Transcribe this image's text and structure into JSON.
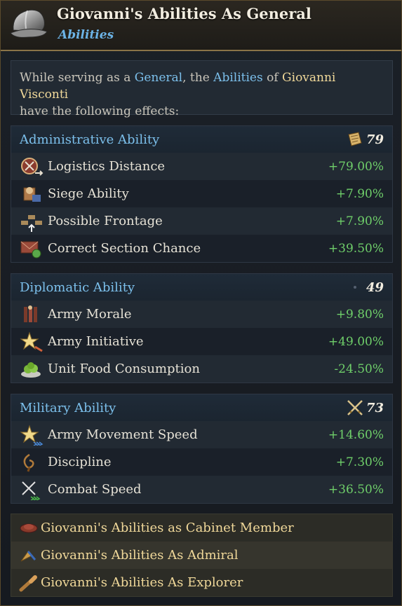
{
  "header": {
    "title": "Giovanni's Abilities As General",
    "subtitle": "Abilities",
    "icon": "helmet-icon"
  },
  "intro": {
    "part1": "While serving as a ",
    "general": "General",
    "part2": ", the ",
    "abilities": "Abilities",
    "part3": " of ",
    "person": "Giovanni Visconti",
    "part4": "have the following effects:"
  },
  "sections": [
    {
      "title": "Administrative Ability",
      "value": "79",
      "icon": "scroll-icon",
      "rows": [
        {
          "label": "Logistics Distance",
          "value": "+79.00%",
          "icon": "logistics-icon"
        },
        {
          "label": "Siege Ability",
          "value": "+7.90%",
          "icon": "siege-icon"
        },
        {
          "label": "Possible Frontage",
          "value": "+7.90%",
          "icon": "frontage-icon"
        },
        {
          "label": "Correct Section Chance",
          "value": "+39.50%",
          "icon": "envelope-icon"
        }
      ]
    },
    {
      "title": "Diplomatic Ability",
      "value": "49",
      "icon": "diplomacy-icon",
      "rows": [
        {
          "label": "Army Morale",
          "value": "+9.80%",
          "icon": "morale-icon"
        },
        {
          "label": "Army Initiative",
          "value": "+49.00%",
          "icon": "initiative-star-icon"
        },
        {
          "label": "Unit Food Consumption",
          "value": "-24.50%",
          "icon": "food-icon"
        }
      ]
    },
    {
      "title": "Military Ability",
      "value": "73",
      "icon": "crossed-swords-icon",
      "rows": [
        {
          "label": "Army Movement Speed",
          "value": "+14.60%",
          "icon": "movement-star-icon"
        },
        {
          "label": "Discipline",
          "value": "+7.30%",
          "icon": "whip-icon"
        },
        {
          "label": "Combat Speed",
          "value": "+36.50%",
          "icon": "combat-swords-icon"
        }
      ]
    }
  ],
  "links": [
    {
      "label": "Giovanni's Abilities as Cabinet Member",
      "icon": "cabinet-hat-icon"
    },
    {
      "label": "Giovanni's Abilities As Admiral",
      "icon": "admiral-icon"
    },
    {
      "label": "Giovanni's Abilities As Explorer",
      "icon": "spyglass-icon"
    }
  ],
  "colors": {
    "accent_blue": "#7cc0ec",
    "positive_green": "#6fcf6a",
    "gold": "#f1d99a"
  }
}
